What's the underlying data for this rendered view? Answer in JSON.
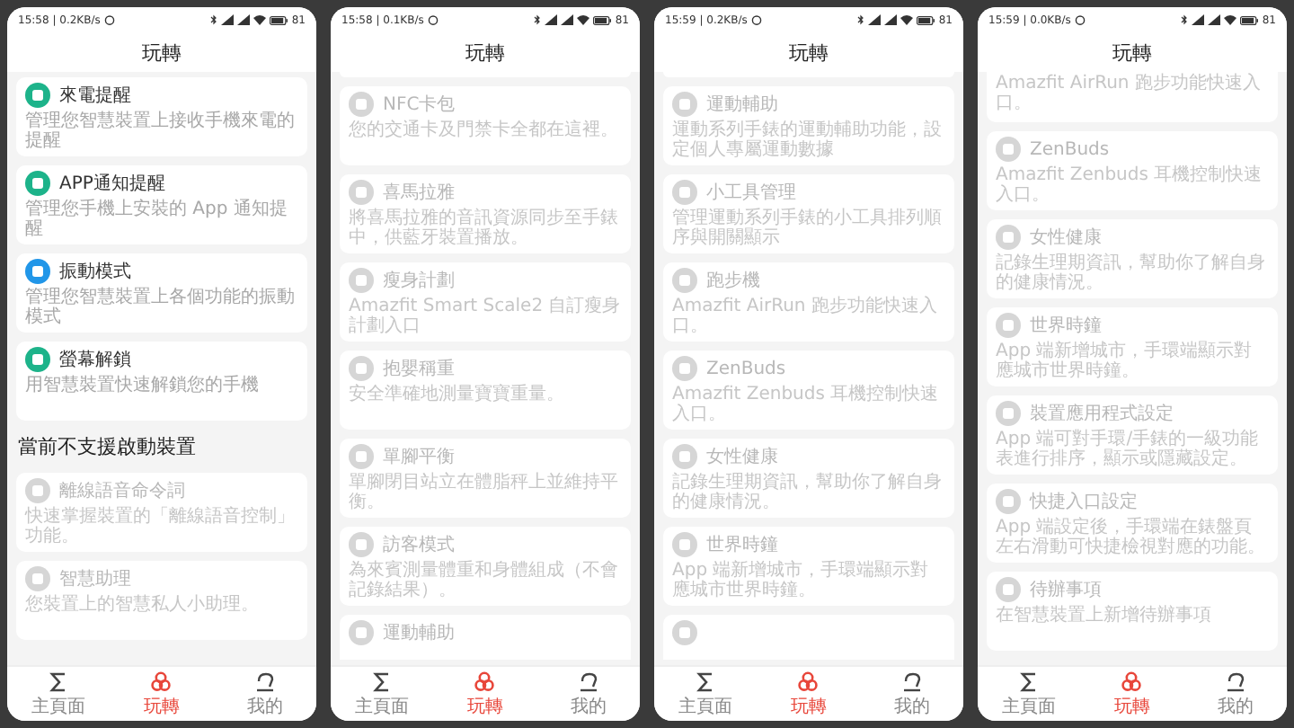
{
  "screens": [
    {
      "status_bar": {
        "time": "15:58 | 0.2KB/s",
        "battery": "81"
      },
      "title": "玩轉",
      "items": [
        {
          "kind": "card",
          "title": "來電提醒",
          "description": "管理您智慧裝置上接收手機來電的提醒",
          "disabled": false,
          "color": "#1db38a"
        },
        {
          "kind": "card",
          "title": "APP通知提醒",
          "description": "管理您手機上安裝的 App 通知提醒",
          "disabled": false,
          "color": "#1db38a"
        },
        {
          "kind": "card",
          "title": "振動模式",
          "description": "管理您智慧裝置上各個功能的振動模式",
          "disabled": false,
          "color": "#2196e8"
        },
        {
          "kind": "card",
          "title": "螢幕解鎖",
          "description": "用智慧裝置快速解鎖您的手機",
          "disabled": false,
          "color": "#1db38a"
        },
        {
          "kind": "section",
          "title": "當前不支援啟動裝置"
        },
        {
          "kind": "card",
          "title": "離線語音命令詞",
          "description": "快速掌握裝置的「離線語音控制」功能。",
          "disabled": true
        },
        {
          "kind": "card",
          "title": "智慧助理",
          "description": "您裝置上的智慧私人小助理。",
          "disabled": true
        }
      ],
      "nav": [
        {
          "label": "主頁面",
          "selected": false
        },
        {
          "label": "玩轉",
          "selected": true
        },
        {
          "label": "我的",
          "selected": false
        }
      ]
    },
    {
      "status_bar": {
        "time": "15:58 | 0.1KB/s",
        "battery": "81"
      },
      "title": "玩轉",
      "items": [
        {
          "kind": "edge"
        },
        {
          "kind": "card",
          "title": "NFC卡包",
          "description": "您的交通卡及門禁卡全都在這裡。",
          "disabled": true
        },
        {
          "kind": "card",
          "title": "喜馬拉雅",
          "description": "將喜馬拉雅的音訊資源同步至手錶中，供藍牙裝置播放。",
          "disabled": true
        },
        {
          "kind": "card",
          "title": "瘦身計劃",
          "description": "Amazfit Smart Scale2 自訂瘦身計劃入口",
          "disabled": true
        },
        {
          "kind": "card",
          "title": "抱嬰稱重",
          "description": "安全準確地測量寶寶重量。",
          "disabled": true
        },
        {
          "kind": "card",
          "title": "單腳平衡",
          "description": "單腳閉目站立在體脂秤上並維持平衡。",
          "disabled": true
        },
        {
          "kind": "card",
          "title": "訪客模式",
          "description": "為來賓測量體重和身體組成（不會記錄結果）。",
          "disabled": true
        },
        {
          "kind": "partial_bottom",
          "title": "運動輔助",
          "disabled": true
        }
      ],
      "nav": [
        {
          "label": "主頁面",
          "selected": false
        },
        {
          "label": "玩轉",
          "selected": true
        },
        {
          "label": "我的",
          "selected": false
        }
      ]
    },
    {
      "status_bar": {
        "time": "15:59 | 0.2KB/s",
        "battery": "81"
      },
      "title": "玩轉",
      "items": [
        {
          "kind": "edge"
        },
        {
          "kind": "card",
          "title": "運動輔助",
          "description": "運動系列手錶的運動輔助功能，設定個人專屬運動數據",
          "disabled": true
        },
        {
          "kind": "card",
          "title": "小工具管理",
          "description": "管理運動系列手錶的小工具排列順序與開關顯示",
          "disabled": true
        },
        {
          "kind": "card",
          "title": "跑步機",
          "description": "Amazfit AirRun 跑步功能快速入口。",
          "disabled": true
        },
        {
          "kind": "card",
          "title": "ZenBuds",
          "description": "Amazfit Zenbuds 耳機控制快速入口。",
          "disabled": true
        },
        {
          "kind": "card",
          "title": "女性健康",
          "description": "記錄生理期資訊，幫助你了解自身的健康情況。",
          "disabled": true
        },
        {
          "kind": "card",
          "title": "世界時鐘",
          "description": "App 端新增城市，手環端顯示對應城市世界時鐘。",
          "disabled": true
        },
        {
          "kind": "partial_bottom",
          "disabled": true
        }
      ],
      "nav": [
        {
          "label": "主頁面",
          "selected": false
        },
        {
          "label": "玩轉",
          "selected": true
        },
        {
          "label": "我的",
          "selected": false
        }
      ]
    },
    {
      "status_bar": {
        "time": "15:59 | 0.0KB/s",
        "battery": "81"
      },
      "title": "玩轉",
      "items": [
        {
          "kind": "partial_top",
          "description": "Amazfit AirRun 跑步功能快速入口。",
          "disabled": true
        },
        {
          "kind": "card",
          "title": "ZenBuds",
          "description": "Amazfit Zenbuds 耳機控制快速入口。",
          "disabled": true
        },
        {
          "kind": "card",
          "title": "女性健康",
          "description": "記錄生理期資訊，幫助你了解自身的健康情況。",
          "disabled": true
        },
        {
          "kind": "card",
          "title": "世界時鐘",
          "description": "App 端新增城市，手環端顯示對應城市世界時鐘。",
          "disabled": true
        },
        {
          "kind": "card",
          "title": "裝置應用程式設定",
          "description": "App 端可對手環/手錶的一級功能表進行排序，顯示或隱藏設定。",
          "disabled": true
        },
        {
          "kind": "card",
          "title": "快捷入口設定",
          "description": "App 端設定後，手環端在錶盤頁左右滑動可快捷檢視對應的功能。",
          "disabled": true
        },
        {
          "kind": "card",
          "title": "待辦事項",
          "description": "在智慧裝置上新增待辦事項",
          "disabled": true
        }
      ],
      "nav": [
        {
          "label": "主頁面",
          "selected": false
        },
        {
          "label": "玩轉",
          "selected": true
        },
        {
          "label": "我的",
          "selected": false
        }
      ]
    }
  ]
}
